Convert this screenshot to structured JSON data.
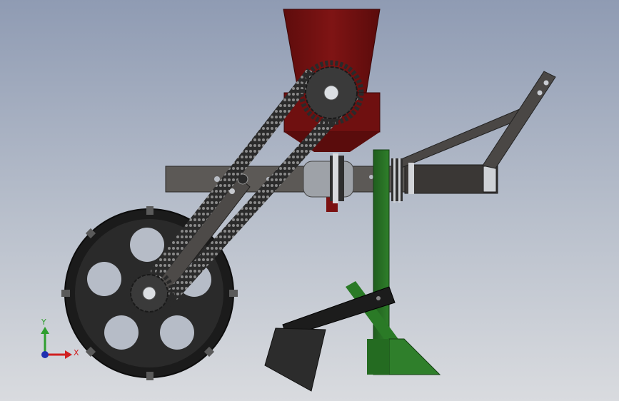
{
  "triad": {
    "y_label": "Y",
    "x_label": "X",
    "y_color": "#2e9e2e",
    "x_color": "#d02020",
    "z_color": "#1f2fb0"
  },
  "colors": {
    "hopper": "#7a1010",
    "frame": "#3a3735",
    "shank": "#2f7a2a",
    "wheel": "#1e1e1e",
    "chain": "#2a2a2a",
    "sprocket": "#3c3c3c"
  },
  "icons": {
    "view_triad": "coordinate-triad-icon"
  }
}
